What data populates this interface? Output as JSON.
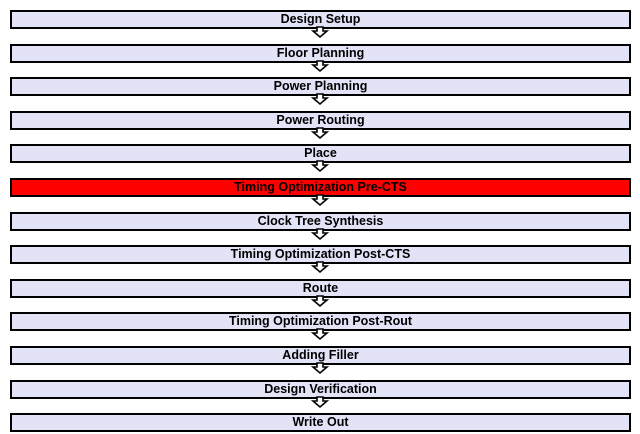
{
  "steps": [
    {
      "label": "Design Setup",
      "active": false
    },
    {
      "label": "Floor Planning",
      "active": false
    },
    {
      "label": "Power Planning",
      "active": false
    },
    {
      "label": "Power Routing",
      "active": false
    },
    {
      "label": "Place",
      "active": false
    },
    {
      "label": "Timing Optimization Pre-CTS",
      "active": true
    },
    {
      "label": "Clock Tree Synthesis",
      "active": false
    },
    {
      "label": "Timing Optimization Post-CTS",
      "active": false
    },
    {
      "label": "Route",
      "active": false
    },
    {
      "label": "Timing Optimization Post-Rout",
      "active": false
    },
    {
      "label": "Adding Filler",
      "active": false
    },
    {
      "label": "Design Verification",
      "active": false
    },
    {
      "label": "Write Out",
      "active": false
    }
  ],
  "colors": {
    "step_fill": "#e3e3f8",
    "active_fill": "#fd0000",
    "arrow_fill": "#ffffff",
    "arrow_stroke": "#000000",
    "border": "#000000"
  },
  "icons": {
    "connector": "down-arrow-icon"
  }
}
